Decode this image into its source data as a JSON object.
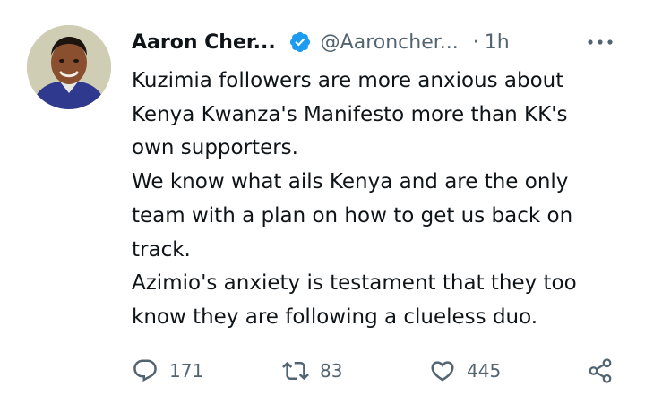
{
  "author": {
    "name": "Aaron Cher...",
    "handle": "@Aaroncher...",
    "separator": "·",
    "time": "1h",
    "verified": true,
    "avatar_icon": "profile-photo"
  },
  "tweet": {
    "lines": [
      "Kuzimia followers are more anxious about",
      "Kenya Kwanza's Manifesto more than KK's",
      "own supporters.",
      "We know what ails Kenya and are the only",
      "team with a plan on how to get us back on",
      "track.",
      "Azimio's anxiety is testament that they too",
      "know they are following a clueless duo."
    ]
  },
  "actions": {
    "reply": {
      "icon": "reply-icon",
      "count": "171"
    },
    "retweet": {
      "icon": "retweet-icon",
      "count": "83"
    },
    "like": {
      "icon": "heart-icon",
      "count": "445"
    },
    "share": {
      "icon": "share-icon"
    }
  },
  "colors": {
    "text": "#0f1419",
    "secondary": "#536471",
    "verified": "#1d9bf0",
    "background": "#ffffff"
  }
}
